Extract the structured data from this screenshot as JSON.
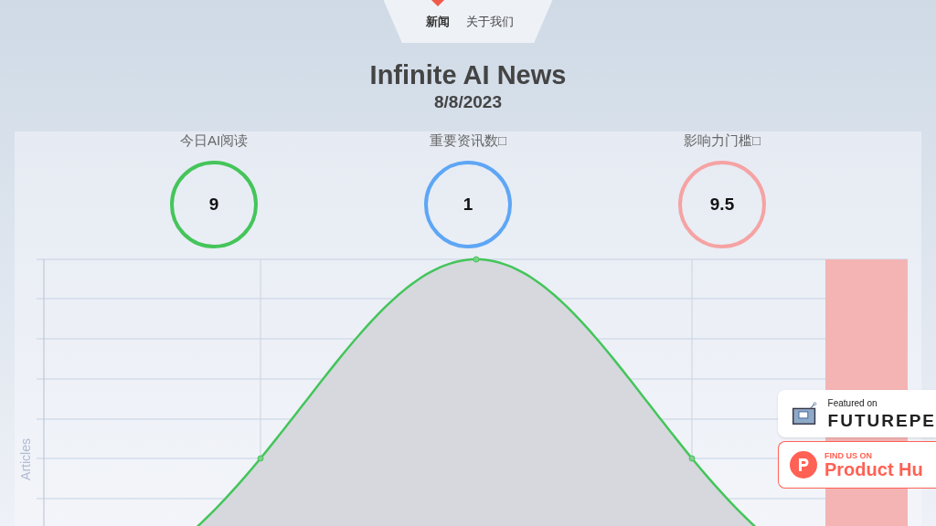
{
  "nav": {
    "items": [
      {
        "label": "新闻",
        "selected": true
      },
      {
        "label": "关于我们",
        "selected": false
      }
    ]
  },
  "title": "Infinite AI News",
  "date": "8/8/2023",
  "stats": [
    {
      "label": "今日AI阅读",
      "value": "9",
      "color": "#44c55a"
    },
    {
      "label": "重要资讯数□",
      "value": "1",
      "color": "#5ea6f5"
    },
    {
      "label": "影响力门槛□",
      "value": "9.5",
      "color": "#f5a3a3"
    }
  ],
  "chart": {
    "y_axis_label": "Articles"
  },
  "badges": [
    {
      "kind": "futurepedia",
      "small": "Featured on",
      "big": "FUTUREPE"
    },
    {
      "kind": "producthunt",
      "small": "FIND US ON",
      "big": "Product Hu"
    }
  ]
}
